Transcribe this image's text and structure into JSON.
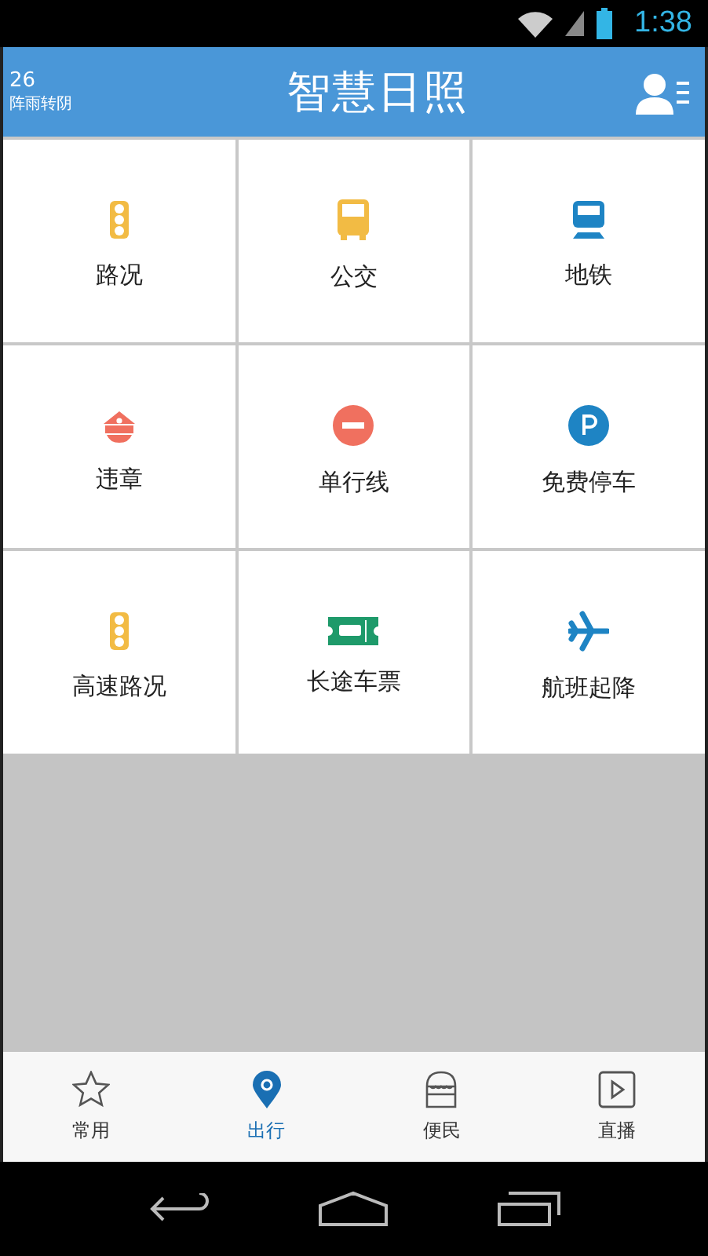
{
  "status_bar": {
    "time": "1:38"
  },
  "header": {
    "temperature": "26",
    "weather": "阵雨转阴",
    "title": "智慧日照"
  },
  "grid": [
    {
      "label": "路况",
      "kind": "traffic-light"
    },
    {
      "label": "公交",
      "kind": "bus"
    },
    {
      "label": "地铁",
      "kind": "train"
    },
    {
      "label": "违章",
      "kind": "police-cap"
    },
    {
      "label": "单行线",
      "kind": "no-entry"
    },
    {
      "label": "免费停车",
      "kind": "parking"
    },
    {
      "label": "高速路况",
      "kind": "traffic-light"
    },
    {
      "label": "长途车票",
      "kind": "ticket"
    },
    {
      "label": "航班起降",
      "kind": "plane"
    }
  ],
  "tabs": [
    {
      "label": "常用",
      "kind": "star",
      "selected": false
    },
    {
      "label": "出行",
      "kind": "pin",
      "selected": true
    },
    {
      "label": "便民",
      "kind": "shop",
      "selected": false
    },
    {
      "label": "直播",
      "kind": "play",
      "selected": false
    }
  ]
}
